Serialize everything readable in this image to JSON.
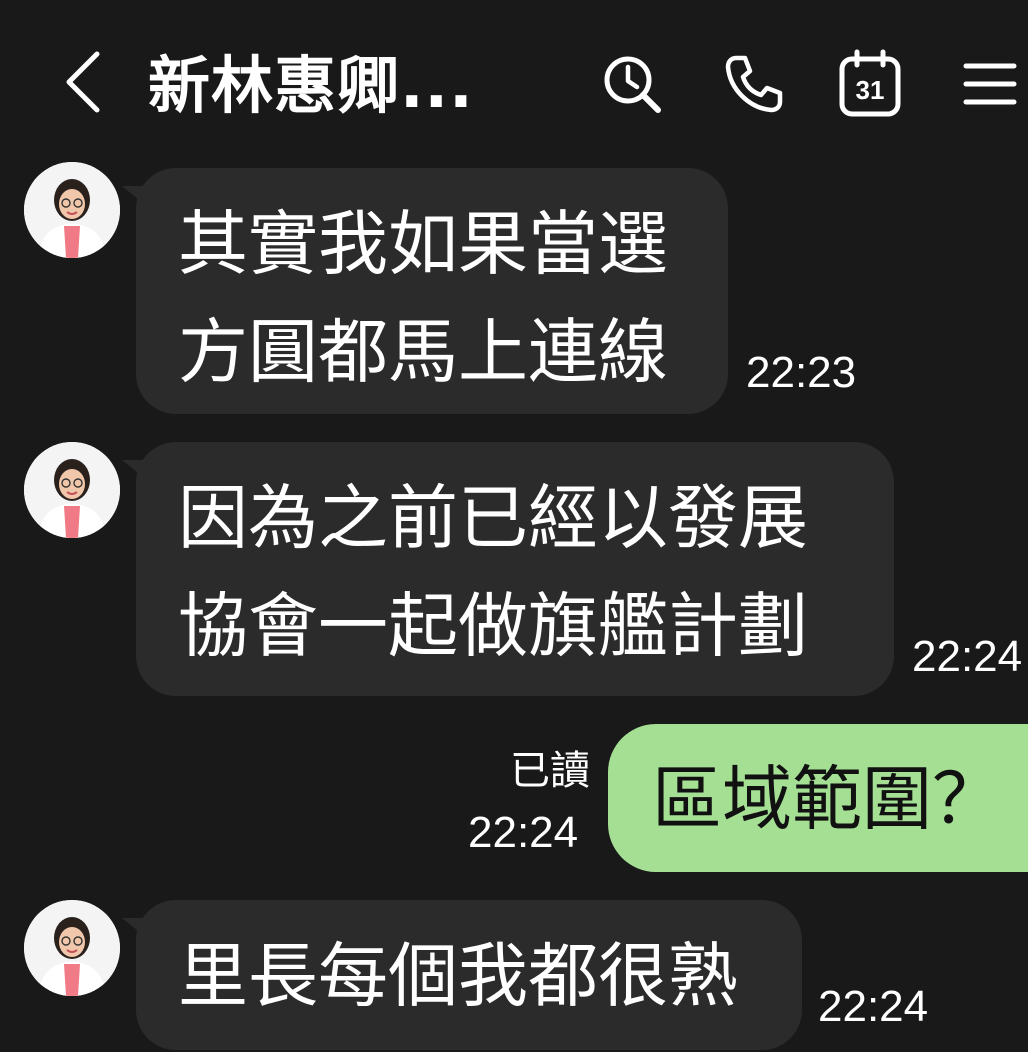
{
  "header": {
    "title": "新林惠卿...",
    "calendar_day": "31"
  },
  "messages": [
    {
      "direction": "in",
      "lines": [
        "其實我如果當選",
        "方圓都馬上連線"
      ],
      "time": "22:23"
    },
    {
      "direction": "in",
      "lines": [
        "因為之前已經以發展",
        "協會一起做旗艦計劃"
      ],
      "time": "22:24"
    },
    {
      "direction": "out",
      "text": "區域範圍？",
      "read": "已讀",
      "time": "22:24"
    },
    {
      "direction": "in",
      "lines": [
        "里長每個我都很熟"
      ],
      "time": "22:24"
    }
  ],
  "colors": {
    "background": "#191919",
    "incoming_bubble": "#2b2b2b",
    "outgoing_bubble": "#a4df93"
  }
}
